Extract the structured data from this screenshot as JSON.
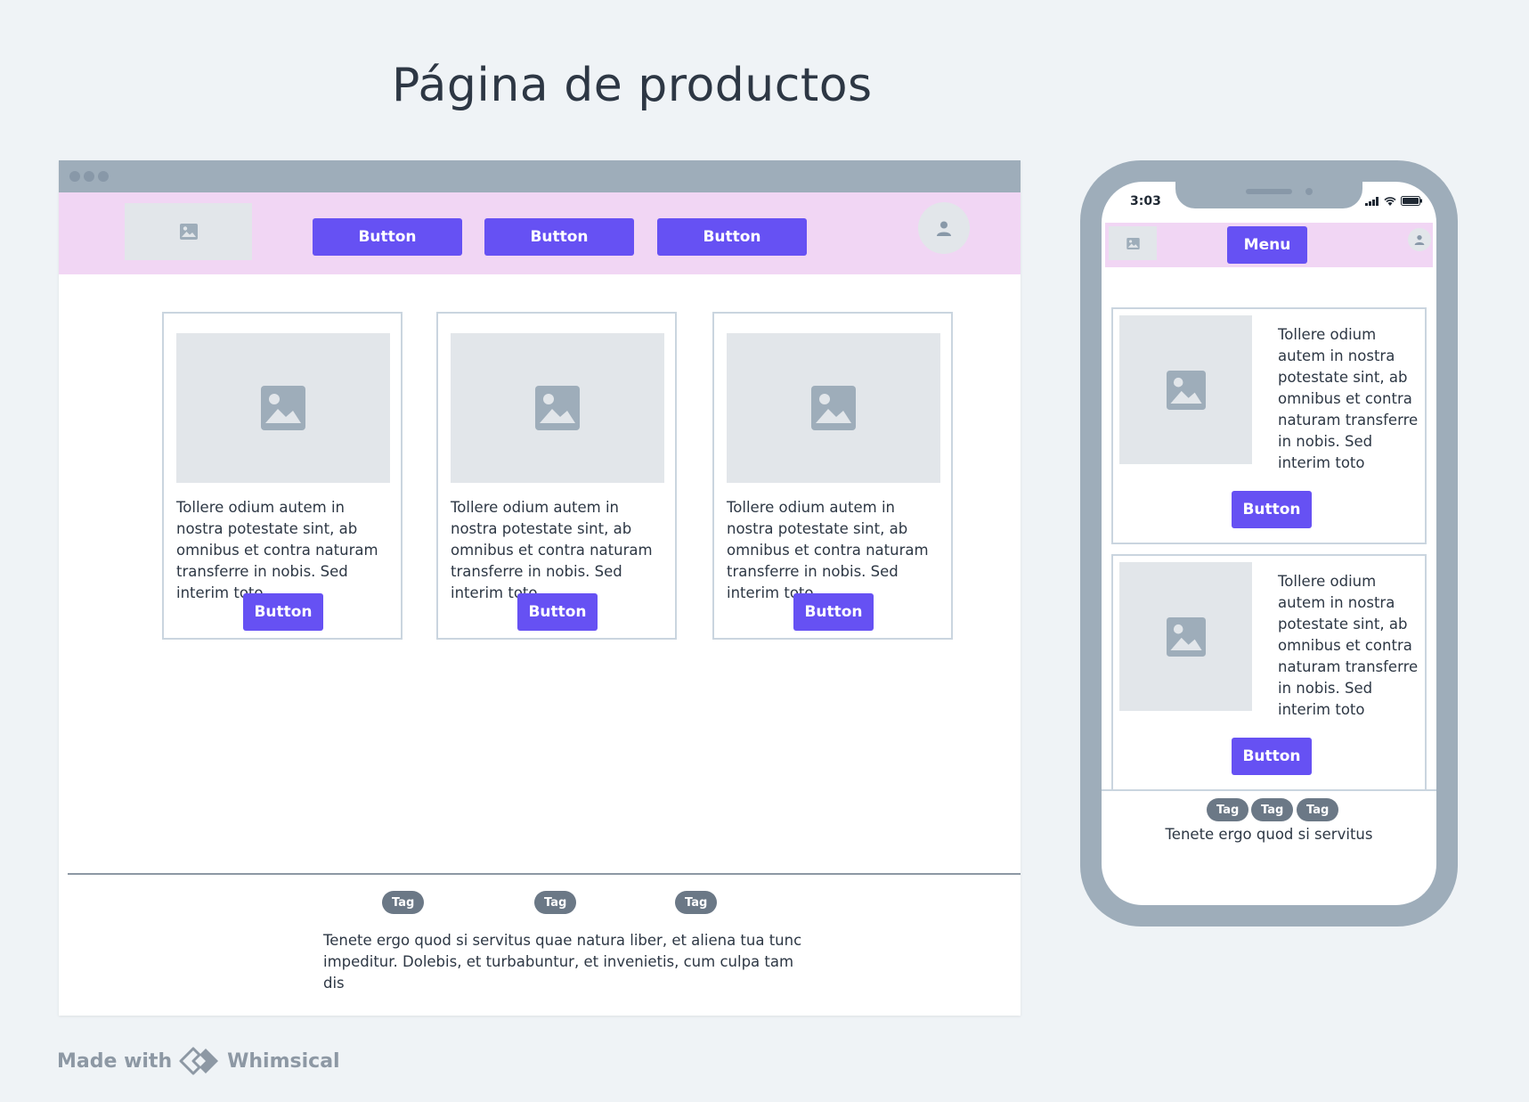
{
  "page": {
    "title": "Página de productos"
  },
  "desktop": {
    "nav_buttons": [
      "Button",
      "Button",
      "Button"
    ],
    "cards": [
      {
        "text": "Tollere odium autem in nostra potestate sint, ab omnibus et contra naturam transferre in nobis. Sed interim toto",
        "button": "Button"
      },
      {
        "text": "Tollere odium autem in nostra potestate sint, ab omnibus et contra naturam transferre in nobis. Sed interim toto",
        "button": "Button"
      },
      {
        "text": "Tollere odium autem in nostra potestate sint, ab omnibus et contra naturam transferre in nobis. Sed interim toto",
        "button": "Button"
      }
    ],
    "footer": {
      "tags": [
        "Tag",
        "Tag",
        "Tag"
      ],
      "text": "Tenete ergo quod si servitus quae natura liber, et aliena tua tunc impeditur. Dolebis, et turbabuntur, et invenietis, cum culpa tam dis"
    }
  },
  "mobile": {
    "time": "3:03",
    "menu_label": "Menu",
    "cards": [
      {
        "text": "Tollere odium autem in nostra potestate sint, ab omnibus et contra naturam transferre in nobis. Sed interim toto",
        "button": "Button"
      },
      {
        "text": "Tollere odium autem in nostra potestate sint, ab omnibus et contra naturam transferre in nobis. Sed interim toto",
        "button": "Button"
      }
    ],
    "footer": {
      "tags": [
        "Tag",
        "Tag",
        "Tag"
      ],
      "text": "Tenete ergo quod si servitus"
    }
  },
  "watermark": {
    "made_with": "Made with",
    "brand": "Whimsical"
  },
  "colors": {
    "accent": "#6651f3",
    "header_bg": "#f1d6f4",
    "placeholder": "#e2e6ea",
    "frame": "#9eadba",
    "tag": "#6b7886"
  },
  "icons": {
    "image": "image-icon",
    "user": "user-icon"
  }
}
